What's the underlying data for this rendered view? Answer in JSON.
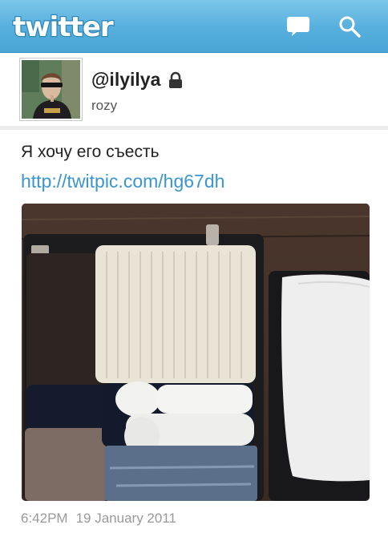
{
  "header": {
    "logo_text": "twitter",
    "compose_icon": "speech-bubble-icon",
    "search_icon": "magnifier-icon",
    "bar_color": "#56afdd"
  },
  "profile": {
    "handle": "@ilyilya",
    "display_name": "rozy",
    "protected_icon": "lock-icon"
  },
  "tweet": {
    "text": "Я хочу его съесть",
    "link": "http://twitpic.com/hg67dh",
    "time": "6:42PM",
    "date": "19 January 2011",
    "link_color": "#3a95d1"
  }
}
